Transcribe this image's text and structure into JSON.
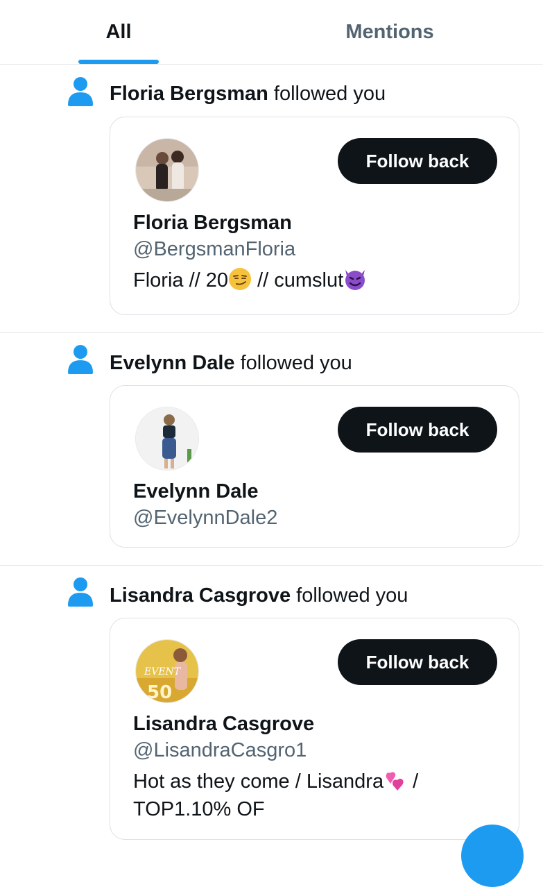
{
  "tabs": [
    {
      "label": "All",
      "active": true
    },
    {
      "label": "Mentions",
      "active": false
    }
  ],
  "colors": {
    "accent": "#1d9bf0",
    "text": "#0f1419",
    "secondary": "#536471",
    "button": "#0f1419"
  },
  "icons": {
    "notification": "person-icon",
    "fab": "compose-button"
  },
  "notifications": [
    {
      "name": "Floria Bergsman",
      "action": "followed you",
      "button_label": "Follow back",
      "display_name": "Floria Bergsman",
      "handle": "@BergsmanFloria",
      "bio_parts": [
        "Floria // 20",
        " // cumslut"
      ],
      "bio_emojis": [
        "smirk-emoji",
        "smiling-devil-emoji"
      ]
    },
    {
      "name": "Evelynn Dale",
      "action": "followed you",
      "button_label": "Follow back",
      "display_name": "Evelynn Dale",
      "handle": "@EvelynnDale2"
    },
    {
      "name": "Lisandra Casgrove",
      "action": "followed you",
      "button_label": "Follow back",
      "display_name": "Lisandra Casgrove",
      "handle": "@LisandraCasgro1",
      "bio_parts": [
        "Hot as they come / Lisandra",
        " /",
        "TOP1.10% OF"
      ],
      "bio_emojis": [
        "two-hearts-emoji"
      ]
    }
  ]
}
